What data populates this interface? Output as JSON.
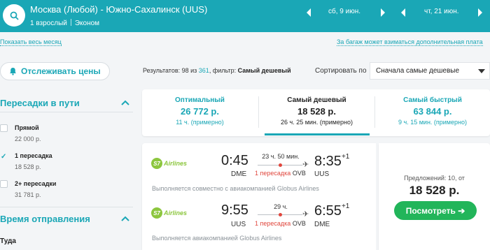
{
  "header": {
    "route": "Москва (Любой) - Южно-Сахалинск (UUS)",
    "passengers": "1 взрослый",
    "cabin": "Эконом",
    "depart_date": "сб, 9 июн.",
    "return_date": "чт, 21 июн.",
    "accent_color": "#1aa7b6"
  },
  "links": {
    "show_month": "Показать весь месяц",
    "baggage_fee": "За багаж может взиматься дополнительная плата"
  },
  "toolbar": {
    "track_prices": "Отслеживать цены",
    "results_prefix": "Результатов: 98 из ",
    "results_total": "361",
    "results_filter": ", фильтр: ",
    "results_filter_value": "Самый дешевый",
    "sort_label": "Сортировать по",
    "sort_value": "Сначала самые дешевые"
  },
  "filters": {
    "stops_title": "Пересадки в пути",
    "stops": [
      {
        "name": "Прямой",
        "price": "22 000 р.",
        "checked": false
      },
      {
        "name": "1 пересадка",
        "price": "18 528 р.",
        "checked": true
      },
      {
        "name": "2+ пересадки",
        "price": "31 781 р.",
        "checked": false
      }
    ],
    "departure_title": "Время отправления",
    "departure_sub": "Туда"
  },
  "tabs": [
    {
      "label": "Оптимальный",
      "price": "26 772 р.",
      "duration": "11 ч. (примерно)"
    },
    {
      "label": "Самый дешевый",
      "price": "18 528 р.",
      "duration": "26 ч. 25 мин. (примерно)"
    },
    {
      "label": "Самый быстрый",
      "price": "63 844 р.",
      "duration": "9 ч. 15 мин. (примерно)"
    }
  ],
  "result": {
    "airline": "Airlines",
    "airline_mark": "S7",
    "outbound": {
      "depart_time": "0:45",
      "arrive_time": "8:35",
      "day_offset": "+1",
      "from": "DME",
      "to": "UUS",
      "duration": "23 ч. 50 мин.",
      "transfer": "1 пересадка",
      "via": "OVB",
      "note": "Выполняется совместно с авиакомпанией Globus Airlines"
    },
    "return": {
      "depart_time": "9:55",
      "arrive_time": "6:55",
      "day_offset": "+1",
      "from": "UUS",
      "to": "DME",
      "duration": "29 ч.",
      "transfer": "1 пересадка",
      "via": "OVB",
      "note": "Выполняется авиакомпанией Globus Airlines"
    },
    "offers": "Предложений: 10, от",
    "price": "18 528 р.",
    "view_button": "Посмотреть ➔"
  }
}
